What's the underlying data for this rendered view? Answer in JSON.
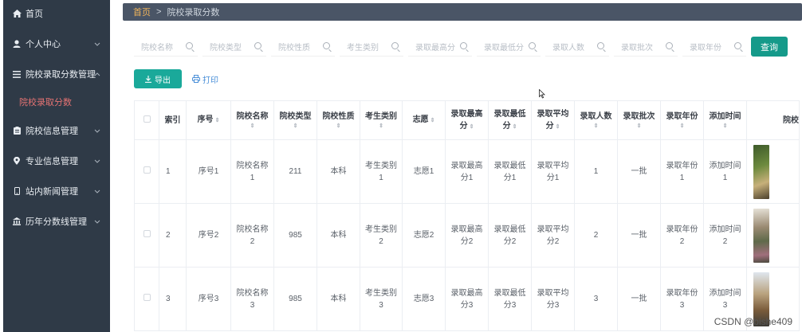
{
  "sidebar": {
    "items": [
      {
        "label": "首页",
        "icon": "home-icon"
      },
      {
        "label": "个人中心",
        "icon": "user-icon"
      },
      {
        "label": "院校录取分数管理",
        "icon": "menu-icon"
      },
      {
        "label": "院校录取分数",
        "icon": ""
      },
      {
        "label": "院校信息管理",
        "icon": "clipboard-icon"
      },
      {
        "label": "专业信息管理",
        "icon": "location-icon"
      },
      {
        "label": "站内新闻管理",
        "icon": "mobile-icon"
      },
      {
        "label": "历年分数线管理",
        "icon": "building-icon"
      }
    ]
  },
  "breadcrumb": {
    "home": "首页",
    "separator": ">",
    "current": "院校录取分数"
  },
  "search": {
    "placeholders": [
      "院校名称",
      "院校类型",
      "院校性质",
      "考生类别",
      "录取最高分",
      "录取最低分",
      "录取人数",
      "录取批次",
      "录取年份"
    ],
    "query_label": "查询"
  },
  "actions": {
    "export_label": "导出",
    "print_label": "打印"
  },
  "table": {
    "headers": [
      "索引",
      "序号",
      "院校名称",
      "院校类型",
      "院校性质",
      "考生类别",
      "志愿",
      "录取最高分",
      "录取最低分",
      "录取平均分",
      "录取人数",
      "录取批次",
      "录取年份",
      "添加时间",
      "院校图片"
    ],
    "header_display": {
      "col2": "院校名称",
      "col7a": "录取最高",
      "col7b": "分",
      "col8a": "录取最低",
      "col8b": "分",
      "col9a": "录取平均",
      "col9b": "分",
      "col10": "录取人数",
      "col11": "录取批次",
      "col12": "录取年份",
      "col13": "添加时间",
      "col14": "院校"
    },
    "rows": [
      {
        "index": "1",
        "seq": "序号1",
        "name_a": "院校名称",
        "name_b": "1",
        "type": "211",
        "nature": "本科",
        "cat_a": "考生类别",
        "cat_b": "1",
        "wish": "志愿1",
        "max_a": "录取最高",
        "max_b": "分1",
        "min_a": "录取最低",
        "min_b": "分1",
        "avg_a": "录取平均",
        "avg_b": "分1",
        "count": "1",
        "batch": "一批",
        "year_a": "录取年份",
        "year_b": "1",
        "time_a": "添加时间",
        "time_b": "1"
      },
      {
        "index": "2",
        "seq": "序号2",
        "name_a": "院校名称",
        "name_b": "2",
        "type": "985",
        "nature": "本科",
        "cat_a": "考生类别",
        "cat_b": "2",
        "wish": "志愿2",
        "max_a": "录取最高",
        "max_b": "分2",
        "min_a": "录取最低",
        "min_b": "分2",
        "avg_a": "录取平均",
        "avg_b": "分2",
        "count": "2",
        "batch": "一批",
        "year_a": "录取年份",
        "year_b": "2",
        "time_a": "添加时间",
        "time_b": "2"
      },
      {
        "index": "3",
        "seq": "序号3",
        "name_a": "院校名称",
        "name_b": "3",
        "type": "985",
        "nature": "本科",
        "cat_a": "考生类别",
        "cat_b": "3",
        "wish": "志愿3",
        "max_a": "录取最高",
        "max_b": "分3",
        "min_a": "录取最低",
        "min_b": "分3",
        "avg_a": "录取平均",
        "avg_b": "分3",
        "count": "3",
        "batch": "一批",
        "year_a": "录取年份",
        "year_b": "3",
        "time_a": "添加时间",
        "time_b": "3"
      }
    ]
  },
  "watermark": "CSDN @bishe409",
  "colors": {
    "sidebar_bg": "#2f3a47",
    "topbar_bg": "#4a5566",
    "accent": "#1aa99a",
    "active_menu": "#e57373",
    "crumb_home": "#f0b45b",
    "link": "#4a8fd8"
  }
}
